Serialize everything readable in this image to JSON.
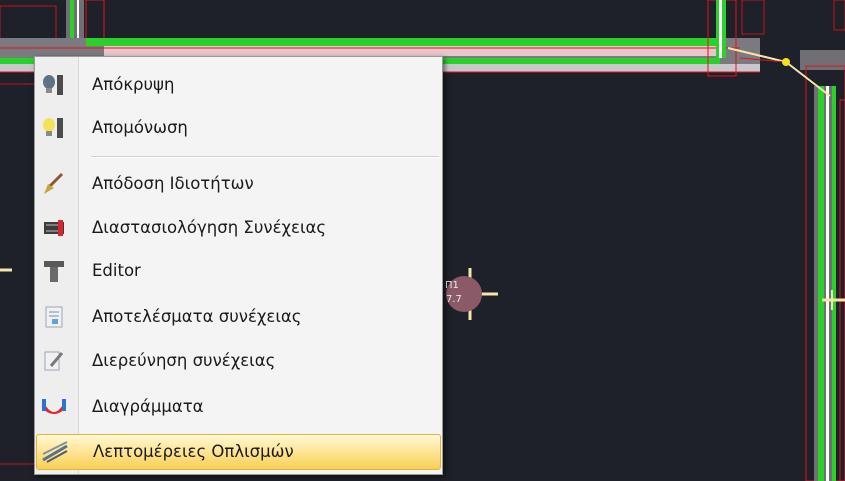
{
  "context_menu": {
    "items": [
      {
        "label": "Απόκρυψη",
        "icon": "lightbulb-dark-icon"
      },
      {
        "label": "Απομόνωση",
        "icon": "lightbulb-lit-icon"
      },
      {
        "label": "Απόδοση Ιδιοτήτων",
        "icon": "brush-icon"
      },
      {
        "label": "Διαστασιολόγηση Συνέχειας",
        "icon": "rebar-section-icon"
      },
      {
        "label": "Editor",
        "icon": "beam-editor-icon"
      },
      {
        "label": "Αποτελέσματα συνέχειας",
        "icon": "results-sheet-icon"
      },
      {
        "label": "Διερεύνηση συνέχειας",
        "icon": "investigation-icon"
      },
      {
        "label": "Διαγράμματα",
        "icon": "diagram-icon"
      },
      {
        "label": "Λεπτομέρειες Οπλισμών",
        "icon": "rebar-details-icon"
      }
    ],
    "highlighted_item": "Λεπτομέρειες Οπλισμών"
  },
  "drawing": {
    "node_label": "Π1",
    "node_value": "7.7"
  },
  "colors": {
    "canvas_bg": "#1e2129",
    "beam_green": "#2bd12b",
    "beam_outline_red": "#e0141d",
    "crosshair_yellow": "#f4e8a6",
    "node_fill": "#8a5a68",
    "menu_highlight": "#f7cf55"
  }
}
